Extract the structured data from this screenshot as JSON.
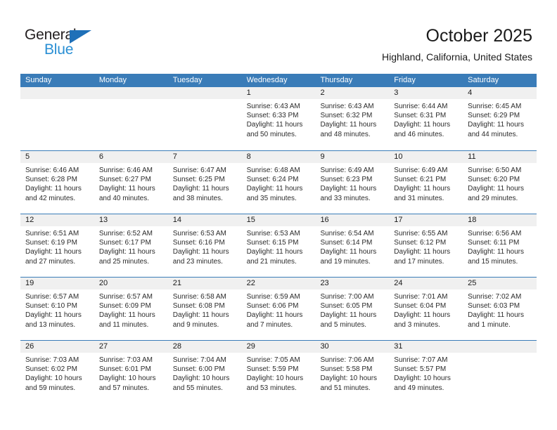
{
  "brand": {
    "name_part1": "General",
    "name_part2": "Blue",
    "triangle_icon": "triangle-icon",
    "color_dark": "#231f20",
    "color_blue": "#2a8fd4",
    "color_triangle": "#1f70b8"
  },
  "header": {
    "title": "October 2025",
    "subtitle": "Highland, California, United States"
  },
  "theme": {
    "header_blue": "#3a7cb8",
    "date_band_gray": "#f0f0f0",
    "text_dark": "#1a1a1a"
  },
  "weekdays": [
    "Sunday",
    "Monday",
    "Tuesday",
    "Wednesday",
    "Thursday",
    "Friday",
    "Saturday"
  ],
  "weeks": [
    [
      {
        "date": "",
        "lines": [
          "",
          "",
          "",
          ""
        ],
        "empty": true
      },
      {
        "date": "",
        "lines": [
          "",
          "",
          "",
          ""
        ],
        "empty": true
      },
      {
        "date": "",
        "lines": [
          "",
          "",
          "",
          ""
        ],
        "empty": true
      },
      {
        "date": "1",
        "lines": [
          "Sunrise: 6:43 AM",
          "Sunset: 6:33 PM",
          "Daylight: 11 hours",
          "and 50 minutes."
        ],
        "empty": false
      },
      {
        "date": "2",
        "lines": [
          "Sunrise: 6:43 AM",
          "Sunset: 6:32 PM",
          "Daylight: 11 hours",
          "and 48 minutes."
        ],
        "empty": false
      },
      {
        "date": "3",
        "lines": [
          "Sunrise: 6:44 AM",
          "Sunset: 6:31 PM",
          "Daylight: 11 hours",
          "and 46 minutes."
        ],
        "empty": false
      },
      {
        "date": "4",
        "lines": [
          "Sunrise: 6:45 AM",
          "Sunset: 6:29 PM",
          "Daylight: 11 hours",
          "and 44 minutes."
        ],
        "empty": false
      }
    ],
    [
      {
        "date": "5",
        "lines": [
          "Sunrise: 6:46 AM",
          "Sunset: 6:28 PM",
          "Daylight: 11 hours",
          "and 42 minutes."
        ],
        "empty": false
      },
      {
        "date": "6",
        "lines": [
          "Sunrise: 6:46 AM",
          "Sunset: 6:27 PM",
          "Daylight: 11 hours",
          "and 40 minutes."
        ],
        "empty": false
      },
      {
        "date": "7",
        "lines": [
          "Sunrise: 6:47 AM",
          "Sunset: 6:25 PM",
          "Daylight: 11 hours",
          "and 38 minutes."
        ],
        "empty": false
      },
      {
        "date": "8",
        "lines": [
          "Sunrise: 6:48 AM",
          "Sunset: 6:24 PM",
          "Daylight: 11 hours",
          "and 35 minutes."
        ],
        "empty": false
      },
      {
        "date": "9",
        "lines": [
          "Sunrise: 6:49 AM",
          "Sunset: 6:23 PM",
          "Daylight: 11 hours",
          "and 33 minutes."
        ],
        "empty": false
      },
      {
        "date": "10",
        "lines": [
          "Sunrise: 6:49 AM",
          "Sunset: 6:21 PM",
          "Daylight: 11 hours",
          "and 31 minutes."
        ],
        "empty": false
      },
      {
        "date": "11",
        "lines": [
          "Sunrise: 6:50 AM",
          "Sunset: 6:20 PM",
          "Daylight: 11 hours",
          "and 29 minutes."
        ],
        "empty": false
      }
    ],
    [
      {
        "date": "12",
        "lines": [
          "Sunrise: 6:51 AM",
          "Sunset: 6:19 PM",
          "Daylight: 11 hours",
          "and 27 minutes."
        ],
        "empty": false
      },
      {
        "date": "13",
        "lines": [
          "Sunrise: 6:52 AM",
          "Sunset: 6:17 PM",
          "Daylight: 11 hours",
          "and 25 minutes."
        ],
        "empty": false
      },
      {
        "date": "14",
        "lines": [
          "Sunrise: 6:53 AM",
          "Sunset: 6:16 PM",
          "Daylight: 11 hours",
          "and 23 minutes."
        ],
        "empty": false
      },
      {
        "date": "15",
        "lines": [
          "Sunrise: 6:53 AM",
          "Sunset: 6:15 PM",
          "Daylight: 11 hours",
          "and 21 minutes."
        ],
        "empty": false
      },
      {
        "date": "16",
        "lines": [
          "Sunrise: 6:54 AM",
          "Sunset: 6:14 PM",
          "Daylight: 11 hours",
          "and 19 minutes."
        ],
        "empty": false
      },
      {
        "date": "17",
        "lines": [
          "Sunrise: 6:55 AM",
          "Sunset: 6:12 PM",
          "Daylight: 11 hours",
          "and 17 minutes."
        ],
        "empty": false
      },
      {
        "date": "18",
        "lines": [
          "Sunrise: 6:56 AM",
          "Sunset: 6:11 PM",
          "Daylight: 11 hours",
          "and 15 minutes."
        ],
        "empty": false
      }
    ],
    [
      {
        "date": "19",
        "lines": [
          "Sunrise: 6:57 AM",
          "Sunset: 6:10 PM",
          "Daylight: 11 hours",
          "and 13 minutes."
        ],
        "empty": false
      },
      {
        "date": "20",
        "lines": [
          "Sunrise: 6:57 AM",
          "Sunset: 6:09 PM",
          "Daylight: 11 hours",
          "and 11 minutes."
        ],
        "empty": false
      },
      {
        "date": "21",
        "lines": [
          "Sunrise: 6:58 AM",
          "Sunset: 6:08 PM",
          "Daylight: 11 hours",
          "and 9 minutes."
        ],
        "empty": false
      },
      {
        "date": "22",
        "lines": [
          "Sunrise: 6:59 AM",
          "Sunset: 6:06 PM",
          "Daylight: 11 hours",
          "and 7 minutes."
        ],
        "empty": false
      },
      {
        "date": "23",
        "lines": [
          "Sunrise: 7:00 AM",
          "Sunset: 6:05 PM",
          "Daylight: 11 hours",
          "and 5 minutes."
        ],
        "empty": false
      },
      {
        "date": "24",
        "lines": [
          "Sunrise: 7:01 AM",
          "Sunset: 6:04 PM",
          "Daylight: 11 hours",
          "and 3 minutes."
        ],
        "empty": false
      },
      {
        "date": "25",
        "lines": [
          "Sunrise: 7:02 AM",
          "Sunset: 6:03 PM",
          "Daylight: 11 hours",
          "and 1 minute."
        ],
        "empty": false
      }
    ],
    [
      {
        "date": "26",
        "lines": [
          "Sunrise: 7:03 AM",
          "Sunset: 6:02 PM",
          "Daylight: 10 hours",
          "and 59 minutes."
        ],
        "empty": false
      },
      {
        "date": "27",
        "lines": [
          "Sunrise: 7:03 AM",
          "Sunset: 6:01 PM",
          "Daylight: 10 hours",
          "and 57 minutes."
        ],
        "empty": false
      },
      {
        "date": "28",
        "lines": [
          "Sunrise: 7:04 AM",
          "Sunset: 6:00 PM",
          "Daylight: 10 hours",
          "and 55 minutes."
        ],
        "empty": false
      },
      {
        "date": "29",
        "lines": [
          "Sunrise: 7:05 AM",
          "Sunset: 5:59 PM",
          "Daylight: 10 hours",
          "and 53 minutes."
        ],
        "empty": false
      },
      {
        "date": "30",
        "lines": [
          "Sunrise: 7:06 AM",
          "Sunset: 5:58 PM",
          "Daylight: 10 hours",
          "and 51 minutes."
        ],
        "empty": false
      },
      {
        "date": "31",
        "lines": [
          "Sunrise: 7:07 AM",
          "Sunset: 5:57 PM",
          "Daylight: 10 hours",
          "and 49 minutes."
        ],
        "empty": false
      },
      {
        "date": "",
        "lines": [
          "",
          "",
          "",
          ""
        ],
        "empty": true
      }
    ]
  ]
}
